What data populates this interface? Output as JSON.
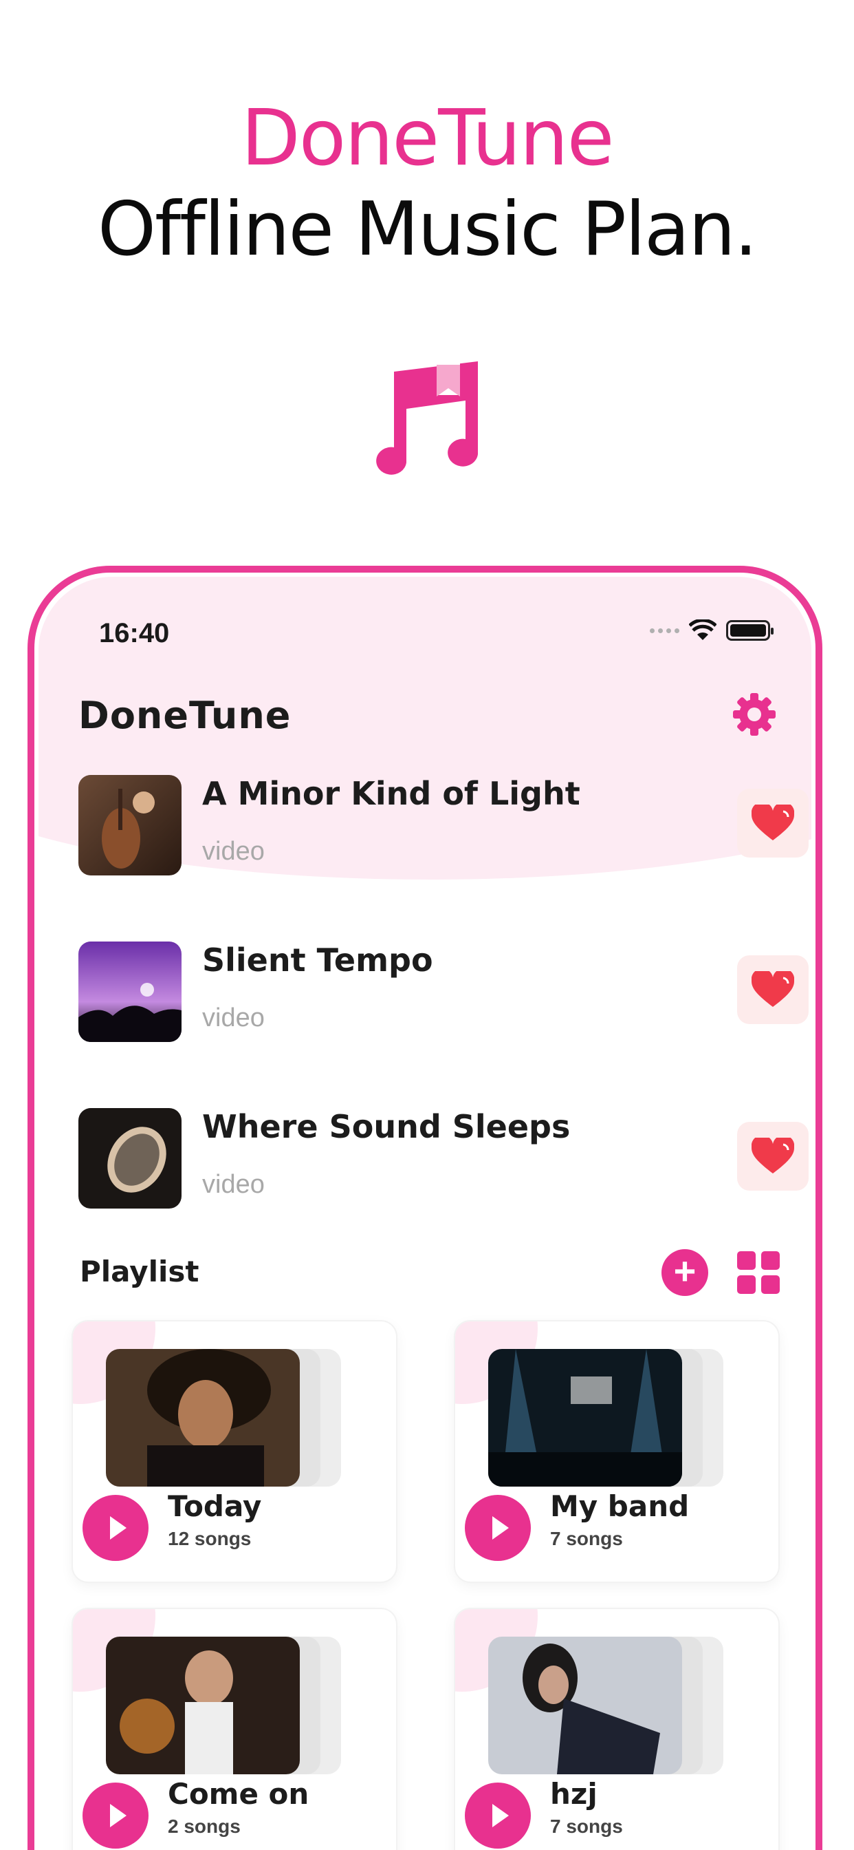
{
  "hero": {
    "title": "DoneTune",
    "subtitle": "Offline Music Plan.",
    "icon": "music-note-icon"
  },
  "status_bar": {
    "time": "16:40",
    "icons": [
      "signal-dots-icon",
      "wifi-icon",
      "battery-icon"
    ]
  },
  "header": {
    "title": "DoneTune",
    "settings_icon": "gear-icon"
  },
  "songs": [
    {
      "title": "A Minor Kind of Light",
      "subtitle": "video",
      "favorite": true
    },
    {
      "title": "Slient Tempo",
      "subtitle": "video",
      "favorite": true
    },
    {
      "title": "Where Sound Sleeps",
      "subtitle": "video",
      "favorite": true
    }
  ],
  "playlist": {
    "title": "Playlist",
    "add_label": "+",
    "items": [
      {
        "name": "Today",
        "count": "12 songs"
      },
      {
        "name": "My band",
        "count": "7 songs"
      },
      {
        "name": "Come on",
        "count": "2 songs"
      },
      {
        "name": "hzj",
        "count": "7 songs"
      }
    ]
  },
  "colors": {
    "accent": "#e8318f",
    "heart": "#f03a4a",
    "heart_bg": "#fdebeb",
    "wash": "#fdebf3"
  }
}
